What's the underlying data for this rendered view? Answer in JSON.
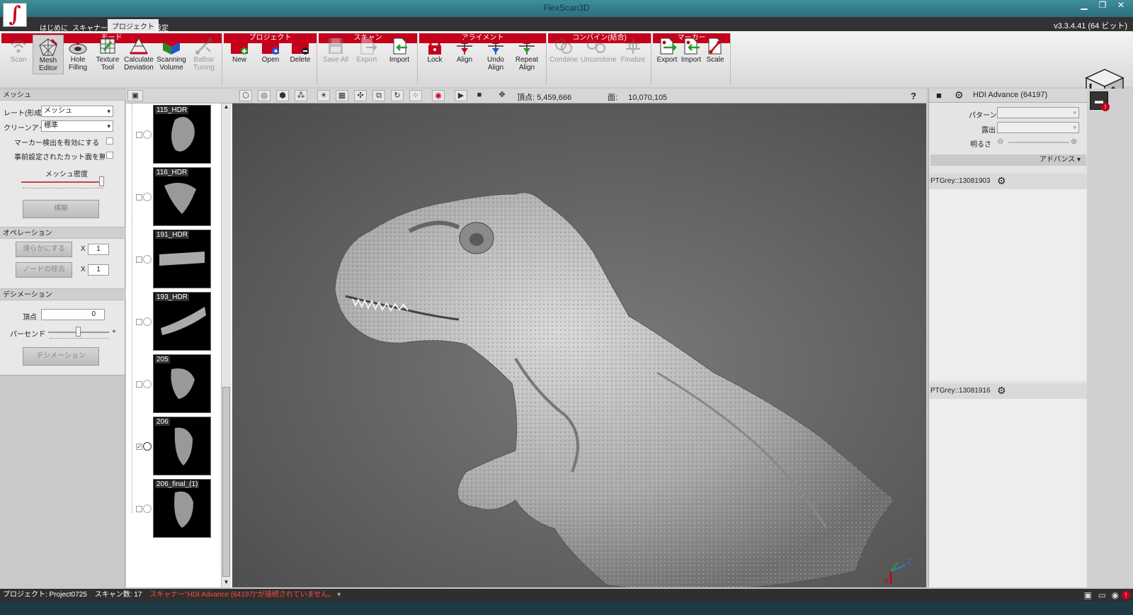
{
  "window": {
    "title": "FlexScan3D",
    "version": "v3.3.4.41 (64 ビット)"
  },
  "menu": [
    "はじめに",
    "スキャナー",
    "プロジェクト",
    "設定"
  ],
  "menu_active": "プロジェクト",
  "ribbon": {
    "groups": [
      {
        "label": "モード",
        "buttons": [
          {
            "label": "Scan",
            "icon": "wifi-scan-icon",
            "disabled": true
          },
          {
            "label": "Mesh Editor",
            "icon": "mesh-editor-icon",
            "selected": true
          },
          {
            "label": "Hole Filling",
            "icon": "hole-filling-icon"
          },
          {
            "label": "Texture Tool",
            "icon": "texture-tool-icon"
          },
          {
            "label": "Calculate Deviation",
            "icon": "deviation-icon"
          },
          {
            "label": "Scanning Volume",
            "icon": "volume-cube-icon"
          },
          {
            "label": "Balbar Tuning",
            "icon": "balbar-icon",
            "disabled": true
          }
        ]
      },
      {
        "label": "プロジェクト",
        "buttons": [
          {
            "label": "New",
            "icon": "new-folder-icon"
          },
          {
            "label": "Open",
            "icon": "open-folder-icon"
          },
          {
            "label": "Delete",
            "icon": "delete-folder-icon"
          }
        ]
      },
      {
        "label": "スキャン",
        "buttons": [
          {
            "label": "Save All",
            "icon": "save-icon",
            "disabled": true
          },
          {
            "label": "Export",
            "icon": "export-icon",
            "disabled": true
          },
          {
            "label": "Import",
            "icon": "import-icon"
          }
        ]
      },
      {
        "label": "アライメント",
        "buttons": [
          {
            "label": "Lock",
            "icon": "lock-icon"
          },
          {
            "label": "Align",
            "icon": "align-icon"
          },
          {
            "label": "Undo Align",
            "icon": "undo-align-icon"
          },
          {
            "label": "Repeat Align",
            "icon": "repeat-align-icon"
          }
        ]
      },
      {
        "label": "コンバイン(結合)",
        "buttons": [
          {
            "label": "Combine",
            "icon": "combine-icon",
            "disabled": true
          },
          {
            "label": "Uncombine",
            "icon": "uncombine-icon",
            "disabled": true
          },
          {
            "label": "Finalize",
            "icon": "finalize-icon",
            "disabled": true
          }
        ]
      },
      {
        "label": "マーカー",
        "buttons": [
          {
            "label": "Export",
            "icon": "marker-export-icon"
          },
          {
            "label": "Import",
            "icon": "marker-import-icon"
          },
          {
            "label": "Scale",
            "icon": "scale-icon"
          }
        ]
      }
    ]
  },
  "left_panel": {
    "mesh": {
      "header": "メッシュ",
      "rate_label": "レート(形成)",
      "rate_value": "メッシュ",
      "cleanup_label": "クリーンアップ",
      "cleanup_value": "標準",
      "marker_detect": "マーカー検出を有効にする",
      "ignore_cut": "事前設定されたカット面を無視す",
      "density_label": "メッシュ密度",
      "density_fraction": 0.98,
      "build_button": "構築"
    },
    "operation": {
      "header": "オペレーション",
      "smooth_button": "滑らかにする",
      "smooth_count": "1",
      "noise_button": "ノードの除去",
      "noise_count": "1",
      "x_mark": "X"
    },
    "decimation": {
      "header": "デシメーション",
      "vertex_label": "頂点",
      "vertex_value": "0",
      "percent_label": "パーセント",
      "minus": "−",
      "plus": "+",
      "percent_fraction": 0.5,
      "decimate_button": "デシメーション"
    }
  },
  "scans": [
    {
      "name": "115_HDR",
      "checked": false
    },
    {
      "name": "116_HDR",
      "checked": false
    },
    {
      "name": "191_HDR",
      "checked": false
    },
    {
      "name": "193_HDR",
      "checked": false
    },
    {
      "name": "205",
      "checked": false
    },
    {
      "name": "206",
      "checked": true
    },
    {
      "name": "206_final_(1)",
      "checked": false
    }
  ],
  "viewport": {
    "vertices_label": "頂点:",
    "vertices_value": "5,459,666",
    "faces_label": "面:",
    "faces_value": "10,070,105",
    "help": "?",
    "axis_z": "Z",
    "axis_x": "X"
  },
  "right_panel": {
    "device": "HDI Advance (64197)",
    "pattern_label": "パターン",
    "exposure_label": "露出",
    "brightness_label": "明るさ",
    "advanced": "アドバンス",
    "camera1": "PTGrey::13081903",
    "camera2": "PTGrey::13081916"
  },
  "status": {
    "project": "プロジェクト: Project0725",
    "scan_count": "スキャン数:  17",
    "warning": "スキャナー\"HDI Advance (64197)\"が接続されていません。"
  },
  "colors": {
    "accent": "#c4001a",
    "title": "#2b6f7c"
  }
}
